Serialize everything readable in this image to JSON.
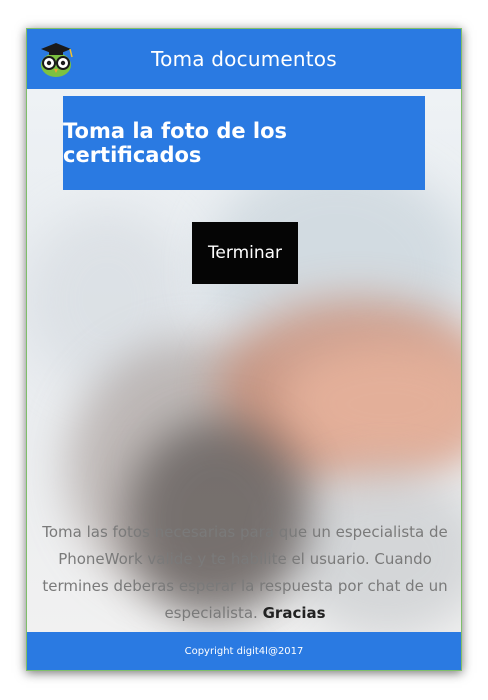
{
  "header": {
    "title": "Toma documentos",
    "logo_icon": "owl-graduate-icon"
  },
  "banner": {
    "text": "Toma la foto de los certificados"
  },
  "actions": {
    "finish_label": "Terminar"
  },
  "info": {
    "message": "Toma las fotos necesarias para que un especialista de PhoneWork valide y te habilite el usuario. Cuando termines deberas esperar la respuesta por chat de un especialista.",
    "thanks": "Gracias"
  },
  "footer": {
    "copyright": "Copyright digit4l@2017"
  },
  "colors": {
    "accent": "#2a7ae2",
    "button_bg": "#050505"
  }
}
